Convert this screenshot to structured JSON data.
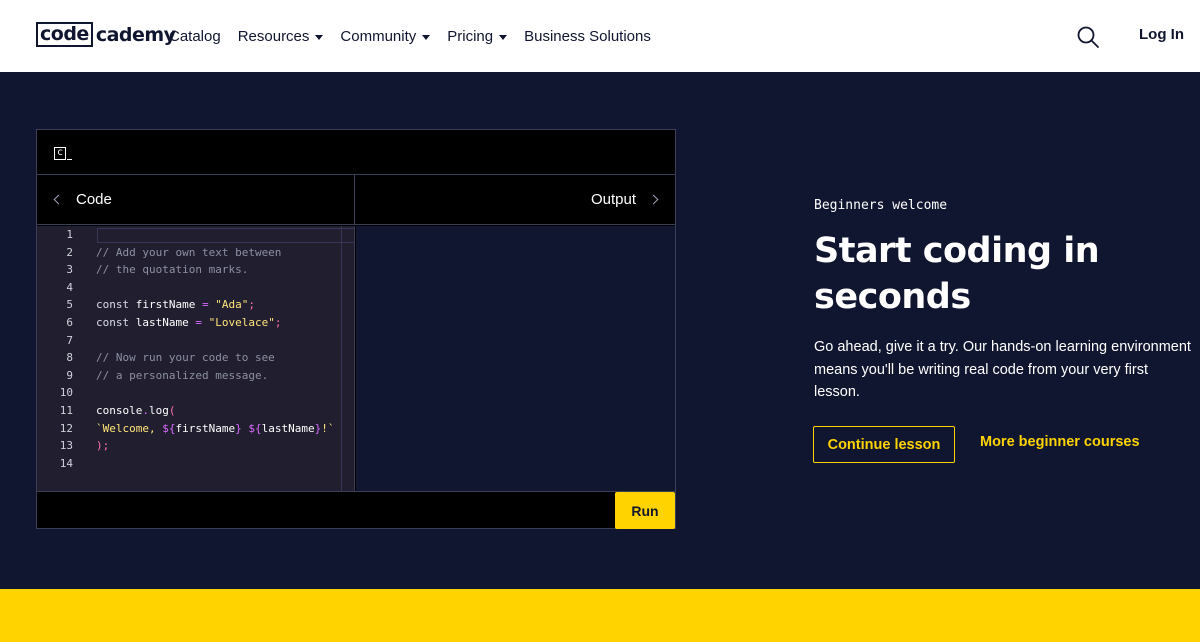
{
  "nav": {
    "logo_boxed": "code",
    "logo_rest": "cademy",
    "links": [
      {
        "label": "Catalog"
      },
      {
        "label": "Resources"
      },
      {
        "label": "Community"
      },
      {
        "label": "Pricing"
      },
      {
        "label": "Business Solutions"
      }
    ],
    "login_label": "Log In"
  },
  "editor": {
    "mini_logo": "c",
    "tab_code": "Code",
    "tab_output": "Output",
    "run_label": "Run",
    "line_numbers": [
      "1",
      "2",
      "3",
      "4",
      "5",
      "6",
      "7",
      "8",
      "9",
      "10",
      "11",
      "12",
      "13",
      "14"
    ],
    "lines": {
      "l2": "// Add your own text between",
      "l3": "// the quotation marks.",
      "l5_kw": "const",
      "l5_var": "firstName",
      "l5_op": "=",
      "l5_str": "\"Ada\"",
      "l5_sc": ";",
      "l6_kw": "const",
      "l6_var": "lastName",
      "l6_op": "=",
      "l6_str": "\"Lovelace\"",
      "l6_sc": ";",
      "l8": "// Now run your code to see",
      "l9": "// a personalized message.",
      "l11_obj": "console",
      "l11_dot": ".",
      "l11_fn": "log",
      "l11_paren": "(",
      "l12_a": "`Welcome, ",
      "l12_b": "${",
      "l12_c": "firstName",
      "l12_d": "}",
      "l12_e": " ",
      "l12_f": "${",
      "l12_g": "lastName",
      "l12_h": "}",
      "l12_i": "!`",
      "l13": ");"
    }
  },
  "hero": {
    "kicker": "Beginners welcome",
    "headline": "Start coding in seconds",
    "description": "Go ahead, give it a try. Our hands-on learning environment means you'll be writing real code from your very first lesson.",
    "continue_label": "Continue lesson",
    "more_label": "More beginner courses"
  },
  "colors": {
    "navy": "#10162f",
    "yellow": "#ffd300",
    "editor_bg": "#211e2f"
  },
  "icons": {
    "search": "search-icon",
    "caret": "caret-down-icon",
    "chevron_left": "chevron-left-icon",
    "chevron_right": "chevron-right-icon"
  }
}
